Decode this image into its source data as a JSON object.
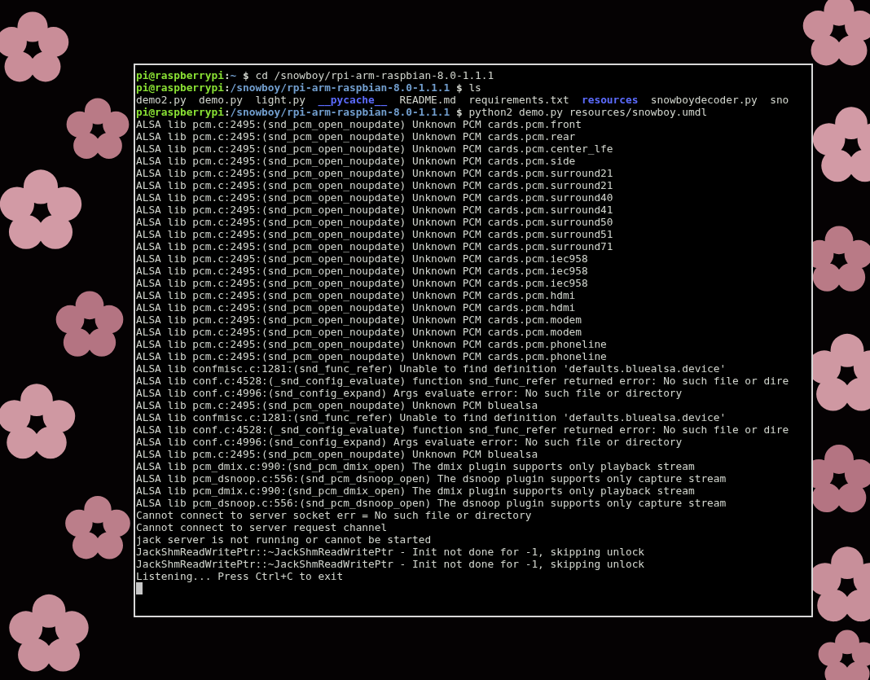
{
  "terminal": {
    "lines": [
      {
        "kind": "prompt",
        "user": "pi@raspberrypi",
        "separator": ":",
        "path": "~",
        "symbol": "$",
        "command": "cd /snowboy/rpi-arm-raspbian-8.0-1.1.1"
      },
      {
        "kind": "prompt",
        "user": "pi@raspberrypi",
        "separator": ":",
        "path": "/snowboy/rpi-arm-raspbian-8.0-1.1.1",
        "symbol": "$",
        "command": "ls"
      },
      {
        "kind": "listing",
        "items": [
          {
            "name": "demo2.py",
            "kind": "file"
          },
          {
            "name": "demo.py",
            "kind": "file"
          },
          {
            "name": "light.py",
            "kind": "file"
          },
          {
            "name": "__pycache__",
            "kind": "dir"
          },
          {
            "name": "README.md",
            "kind": "file"
          },
          {
            "name": "requirements.txt",
            "kind": "file"
          },
          {
            "name": "resources",
            "kind": "dir"
          },
          {
            "name": "snowboydecoder.py",
            "kind": "file"
          },
          {
            "name": "sno",
            "kind": "file"
          }
        ]
      },
      {
        "kind": "prompt",
        "user": "pi@raspberrypi",
        "separator": ":",
        "path": "/snowboy/rpi-arm-raspbian-8.0-1.1.1",
        "symbol": "$",
        "command": "python2 demo.py resources/snowboy.umdl"
      },
      {
        "kind": "output",
        "text": "ALSA lib pcm.c:2495:(snd_pcm_open_noupdate) Unknown PCM cards.pcm.front"
      },
      {
        "kind": "output",
        "text": "ALSA lib pcm.c:2495:(snd_pcm_open_noupdate) Unknown PCM cards.pcm.rear"
      },
      {
        "kind": "output",
        "text": "ALSA lib pcm.c:2495:(snd_pcm_open_noupdate) Unknown PCM cards.pcm.center_lfe"
      },
      {
        "kind": "output",
        "text": "ALSA lib pcm.c:2495:(snd_pcm_open_noupdate) Unknown PCM cards.pcm.side"
      },
      {
        "kind": "output",
        "text": "ALSA lib pcm.c:2495:(snd_pcm_open_noupdate) Unknown PCM cards.pcm.surround21"
      },
      {
        "kind": "output",
        "text": "ALSA lib pcm.c:2495:(snd_pcm_open_noupdate) Unknown PCM cards.pcm.surround21"
      },
      {
        "kind": "output",
        "text": "ALSA lib pcm.c:2495:(snd_pcm_open_noupdate) Unknown PCM cards.pcm.surround40"
      },
      {
        "kind": "output",
        "text": "ALSA lib pcm.c:2495:(snd_pcm_open_noupdate) Unknown PCM cards.pcm.surround41"
      },
      {
        "kind": "output",
        "text": "ALSA lib pcm.c:2495:(snd_pcm_open_noupdate) Unknown PCM cards.pcm.surround50"
      },
      {
        "kind": "output",
        "text": "ALSA lib pcm.c:2495:(snd_pcm_open_noupdate) Unknown PCM cards.pcm.surround51"
      },
      {
        "kind": "output",
        "text": "ALSA lib pcm.c:2495:(snd_pcm_open_noupdate) Unknown PCM cards.pcm.surround71"
      },
      {
        "kind": "output",
        "text": "ALSA lib pcm.c:2495:(snd_pcm_open_noupdate) Unknown PCM cards.pcm.iec958"
      },
      {
        "kind": "output",
        "text": "ALSA lib pcm.c:2495:(snd_pcm_open_noupdate) Unknown PCM cards.pcm.iec958"
      },
      {
        "kind": "output",
        "text": "ALSA lib pcm.c:2495:(snd_pcm_open_noupdate) Unknown PCM cards.pcm.iec958"
      },
      {
        "kind": "output",
        "text": "ALSA lib pcm.c:2495:(snd_pcm_open_noupdate) Unknown PCM cards.pcm.hdmi"
      },
      {
        "kind": "output",
        "text": "ALSA lib pcm.c:2495:(snd_pcm_open_noupdate) Unknown PCM cards.pcm.hdmi"
      },
      {
        "kind": "output",
        "text": "ALSA lib pcm.c:2495:(snd_pcm_open_noupdate) Unknown PCM cards.pcm.modem"
      },
      {
        "kind": "output",
        "text": "ALSA lib pcm.c:2495:(snd_pcm_open_noupdate) Unknown PCM cards.pcm.modem"
      },
      {
        "kind": "output",
        "text": "ALSA lib pcm.c:2495:(snd_pcm_open_noupdate) Unknown PCM cards.pcm.phoneline"
      },
      {
        "kind": "output",
        "text": "ALSA lib pcm.c:2495:(snd_pcm_open_noupdate) Unknown PCM cards.pcm.phoneline"
      },
      {
        "kind": "output",
        "text": "ALSA lib confmisc.c:1281:(snd_func_refer) Unable to find definition 'defaults.bluealsa.device'"
      },
      {
        "kind": "output",
        "text": "ALSA lib conf.c:4528:(_snd_config_evaluate) function snd_func_refer returned error: No such file or dire"
      },
      {
        "kind": "output",
        "text": "ALSA lib conf.c:4996:(snd_config_expand) Args evaluate error: No such file or directory"
      },
      {
        "kind": "output",
        "text": "ALSA lib pcm.c:2495:(snd_pcm_open_noupdate) Unknown PCM bluealsa"
      },
      {
        "kind": "output",
        "text": "ALSA lib confmisc.c:1281:(snd_func_refer) Unable to find definition 'defaults.bluealsa.device'"
      },
      {
        "kind": "output",
        "text": "ALSA lib conf.c:4528:(_snd_config_evaluate) function snd_func_refer returned error: No such file or dire"
      },
      {
        "kind": "output",
        "text": "ALSA lib conf.c:4996:(snd_config_expand) Args evaluate error: No such file or directory"
      },
      {
        "kind": "output",
        "text": "ALSA lib pcm.c:2495:(snd_pcm_open_noupdate) Unknown PCM bluealsa"
      },
      {
        "kind": "output",
        "text": "ALSA lib pcm_dmix.c:990:(snd_pcm_dmix_open) The dmix plugin supports only playback stream"
      },
      {
        "kind": "output",
        "text": "ALSA lib pcm_dsnoop.c:556:(snd_pcm_dsnoop_open) The dsnoop plugin supports only capture stream"
      },
      {
        "kind": "output",
        "text": "ALSA lib pcm_dmix.c:990:(snd_pcm_dmix_open) The dmix plugin supports only playback stream"
      },
      {
        "kind": "output",
        "text": "ALSA lib pcm_dsnoop.c:556:(snd_pcm_dsnoop_open) The dsnoop plugin supports only capture stream"
      },
      {
        "kind": "output",
        "text": "Cannot connect to server socket err = No such file or directory"
      },
      {
        "kind": "output",
        "text": "Cannot connect to server request channel"
      },
      {
        "kind": "output",
        "text": "jack server is not running or cannot be started"
      },
      {
        "kind": "output",
        "text": "JackShmReadWritePtr::~JackShmReadWritePtr - Init not done for -1, skipping unlock"
      },
      {
        "kind": "output",
        "text": "JackShmReadWritePtr::~JackShmReadWritePtr - Init not done for -1, skipping unlock"
      },
      {
        "kind": "output",
        "text": "Listening... Press Ctrl+C to exit"
      },
      {
        "kind": "cursor"
      }
    ]
  }
}
